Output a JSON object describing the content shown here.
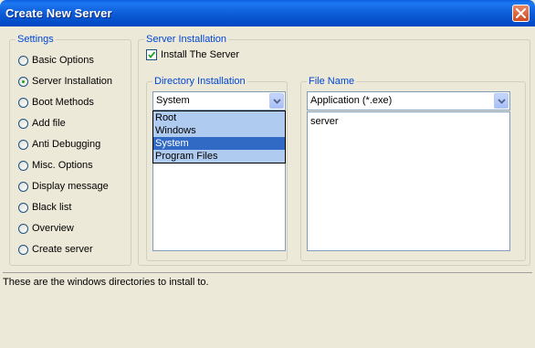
{
  "window": {
    "title": "Create New Server",
    "close_icon": "close-icon",
    "accent": "#0A5FE0"
  },
  "settings": {
    "legend": "Settings",
    "items": [
      {
        "label": "Basic Options",
        "checked": false
      },
      {
        "label": "Server Installation",
        "checked": true
      },
      {
        "label": "Boot Methods",
        "checked": false
      },
      {
        "label": "Add file",
        "checked": false
      },
      {
        "label": "Anti Debugging",
        "checked": false
      },
      {
        "label": "Misc. Options",
        "checked": false
      },
      {
        "label": "Display message",
        "checked": false
      },
      {
        "label": "Black list",
        "checked": false
      },
      {
        "label": "Overview",
        "checked": false
      },
      {
        "label": "Create server",
        "checked": false
      }
    ]
  },
  "server_installation": {
    "legend": "Server Installation",
    "install_label": "Install The Server",
    "install_checked": true,
    "directory": {
      "legend": "Directory Installation",
      "selected": "System",
      "options": [
        "Root",
        "Windows",
        "System",
        "Program Files"
      ],
      "highlighted_index": 2
    },
    "file_name": {
      "legend": "File Name",
      "selected": "Application (*.exe)",
      "value": "server"
    }
  },
  "status": {
    "text": "These are the windows directories to install to."
  }
}
